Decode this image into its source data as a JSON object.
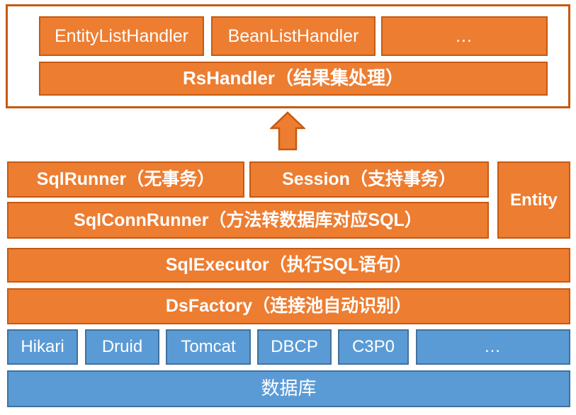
{
  "diagram": {
    "title": "Hutool DB layered architecture",
    "colors": {
      "orange_fill": "#ED7D31",
      "orange_border": "#C55A11",
      "blue_fill": "#5B9BD5",
      "blue_border": "#41719C",
      "text": "#FFFFFF",
      "background": "#FFFFFF"
    },
    "handler_layer": {
      "handlers": [
        {
          "label": "EntityListHandler"
        },
        {
          "label": "BeanListHandler"
        },
        {
          "label": "…"
        }
      ],
      "base": {
        "label": "RsHandler（结果集处理）"
      }
    },
    "arrow": {
      "name": "up-arrow",
      "direction": "up"
    },
    "runner_layer": {
      "runners": [
        {
          "label": "SqlRunner（无事务）"
        },
        {
          "label": "Session（支持事务）"
        }
      ],
      "conn_runner": {
        "label": "SqlConnRunner（方法转数据库对应SQL）"
      },
      "entity": {
        "label": "Entity"
      }
    },
    "executor": {
      "label": "SqlExecutor（执行SQL语句）"
    },
    "ds_factory": {
      "label": "DsFactory（连接池自动识别）"
    },
    "pools": [
      {
        "label": "Hikari"
      },
      {
        "label": "Druid"
      },
      {
        "label": "Tomcat"
      },
      {
        "label": "DBCP"
      },
      {
        "label": "C3P0"
      },
      {
        "label": "…"
      }
    ],
    "database": {
      "label": "数据库"
    }
  }
}
